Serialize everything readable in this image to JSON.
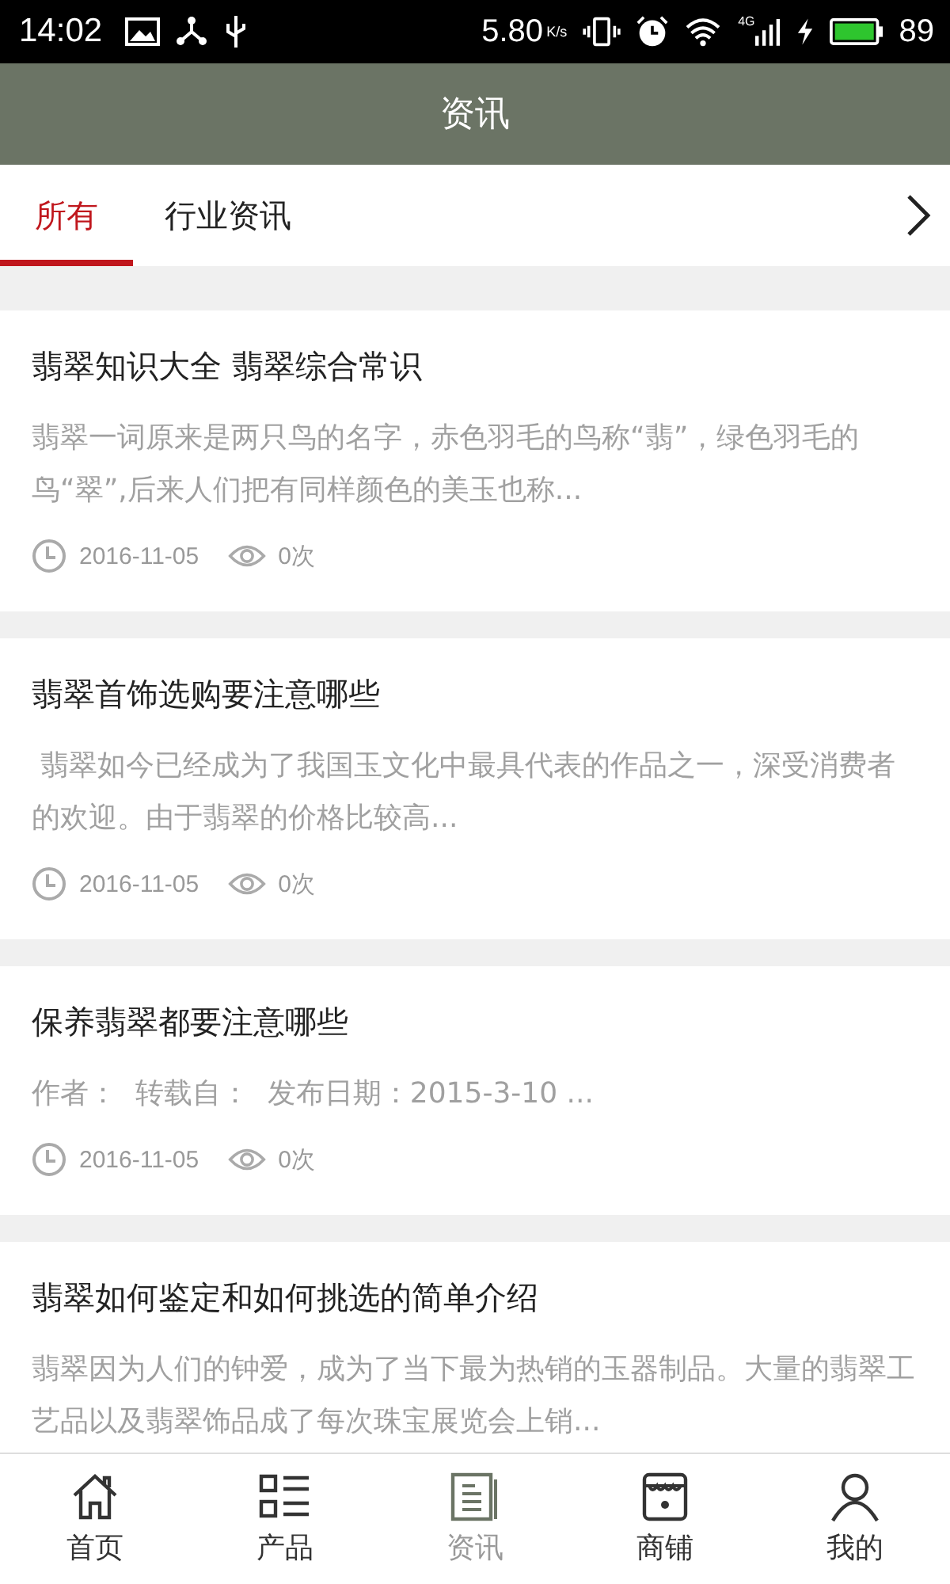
{
  "status_bar": {
    "time": "14:02",
    "speed": "5.80",
    "speed_unit": "K/s",
    "network": "4G",
    "battery": "89"
  },
  "header": {
    "title": "资讯"
  },
  "tabs": [
    {
      "label": "所有",
      "selected": true
    },
    {
      "label": "行业资讯",
      "selected": false
    }
  ],
  "articles": [
    {
      "title": "翡翠知识大全 翡翠综合常识",
      "summary": "翡翠一词原来是两只鸟的名字，赤色羽毛的鸟称“翡”，绿色羽毛的鸟“翠”,后来人们把有同样颜色的美玉也称...",
      "date": "2016-11-05",
      "views": "0次"
    },
    {
      "title": "翡翠首饰选购要注意哪些",
      "summary": " 翡翠如今已经成为了我国玉文化中最具代表的作品之一，深受消费者的欢迎。由于翡翠的价格比较高...",
      "date": "2016-11-05",
      "views": "0次"
    },
    {
      "title": "保养翡翠都要注意哪些",
      "summary": "作者：  转载自：  发布日期：2015-3-10 ...",
      "date": "2016-11-05",
      "views": "0次"
    },
    {
      "title": "翡翠如何鉴定和如何挑选的简单介绍",
      "summary": "翡翠因为人们的钟爱，成为了当下最为热销的玉器制品。大量的翡翠工艺品以及翡翠饰品成了每次珠宝展览会上销..."
    }
  ],
  "bottom_nav": [
    {
      "label": "首页",
      "kind": "home",
      "selected": false
    },
    {
      "label": "产品",
      "kind": "list",
      "selected": false
    },
    {
      "label": "资讯",
      "kind": "news",
      "selected": true
    },
    {
      "label": "商铺",
      "kind": "shop",
      "selected": false
    },
    {
      "label": "我的",
      "kind": "user",
      "selected": false
    }
  ]
}
